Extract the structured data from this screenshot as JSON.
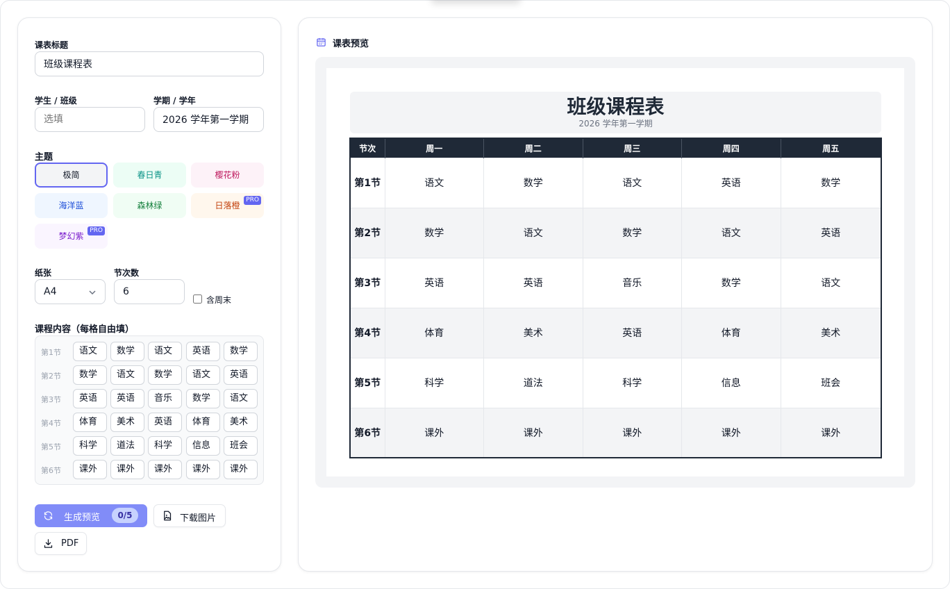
{
  "form": {
    "title_label": "课表标题",
    "title_value": "班级课程表",
    "student_label": "学生 / 班级",
    "student_placeholder": "选填",
    "term_label": "学期 / 学年",
    "term_value": "2026 学年第一学期",
    "theme_label": "主题",
    "themes": [
      {
        "label": "极简",
        "selected": true
      },
      {
        "label": "春日青"
      },
      {
        "label": "樱花粉"
      },
      {
        "label": "海洋蓝"
      },
      {
        "label": "森林绿"
      },
      {
        "label": "日落橙",
        "badge": "PRO"
      },
      {
        "label": "梦幻紫",
        "badge": "PRO"
      }
    ],
    "paper_label": "纸张",
    "paper_value": "A4",
    "periods_label": "节次数",
    "periods_value": "6",
    "weekend_label": "含周末",
    "weekend_checked": false,
    "content_label": "课程内容（每格自由填）",
    "rows": [
      {
        "label": "第1节",
        "cells": [
          "语文",
          "数学",
          "语文",
          "英语",
          "数学"
        ]
      },
      {
        "label": "第2节",
        "cells": [
          "数学",
          "语文",
          "数学",
          "语文",
          "英语"
        ]
      },
      {
        "label": "第3节",
        "cells": [
          "英语",
          "英语",
          "音乐",
          "数学",
          "语文"
        ]
      },
      {
        "label": "第4节",
        "cells": [
          "体育",
          "美术",
          "英语",
          "体育",
          "美术"
        ]
      },
      {
        "label": "第5节",
        "cells": [
          "科学",
          "道法",
          "科学",
          "信息",
          "班会"
        ]
      },
      {
        "label": "第6节",
        "cells": [
          "课外",
          "课外",
          "课外",
          "课外",
          "课外"
        ]
      }
    ]
  },
  "actions": {
    "generate_label": "生成预览",
    "generate_counter": "0/5",
    "download_image_label": "下载图片",
    "pdf_label": "PDF"
  },
  "preview": {
    "header": "课表预览",
    "title": "班级课程表",
    "subtitle": "2026 学年第一学期",
    "columns": [
      "节次",
      "周一",
      "周二",
      "周三",
      "周四",
      "周五"
    ],
    "rows": [
      {
        "label": "第1节",
        "cells": [
          "语文",
          "数学",
          "语文",
          "英语",
          "数学"
        ]
      },
      {
        "label": "第2节",
        "cells": [
          "数学",
          "语文",
          "数学",
          "语文",
          "英语"
        ]
      },
      {
        "label": "第3节",
        "cells": [
          "英语",
          "英语",
          "音乐",
          "数学",
          "语文"
        ]
      },
      {
        "label": "第4节",
        "cells": [
          "体育",
          "美术",
          "英语",
          "体育",
          "美术"
        ]
      },
      {
        "label": "第5节",
        "cells": [
          "科学",
          "道法",
          "科学",
          "信息",
          "班会"
        ]
      },
      {
        "label": "第6节",
        "cells": [
          "课外",
          "课外",
          "课外",
          "课外",
          "课外"
        ]
      }
    ]
  },
  "colors": {
    "accent": "#818cf8",
    "table_header": "#1f2937"
  }
}
